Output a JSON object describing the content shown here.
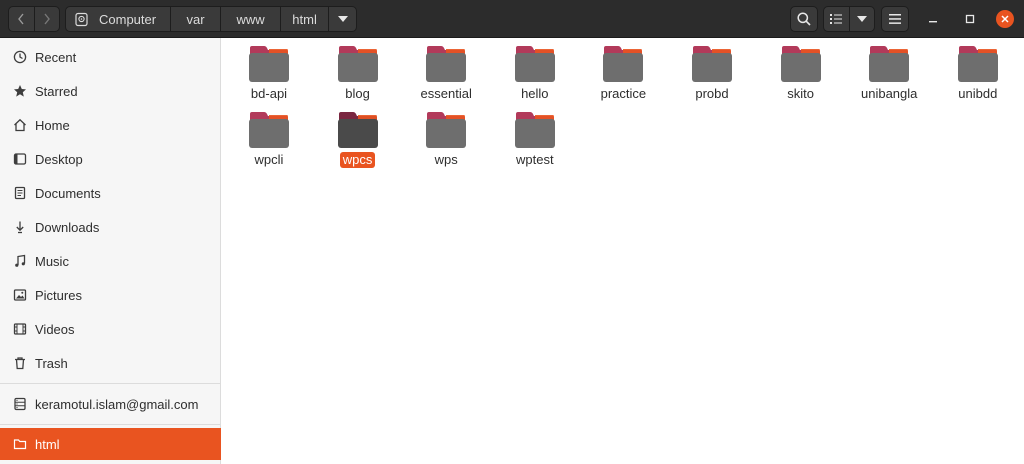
{
  "path": {
    "crumbs": [
      "Computer",
      "var",
      "www",
      "html"
    ]
  },
  "sidebar": {
    "places": [
      {
        "label": "Recent",
        "icon": "clock-icon"
      },
      {
        "label": "Starred",
        "icon": "star-icon"
      },
      {
        "label": "Home",
        "icon": "home-icon"
      },
      {
        "label": "Desktop",
        "icon": "desktop-icon"
      },
      {
        "label": "Documents",
        "icon": "document-icon"
      },
      {
        "label": "Downloads",
        "icon": "download-icon"
      },
      {
        "label": "Music",
        "icon": "music-icon"
      },
      {
        "label": "Pictures",
        "icon": "picture-icon"
      },
      {
        "label": "Videos",
        "icon": "video-icon"
      },
      {
        "label": "Trash",
        "icon": "trash-icon"
      }
    ],
    "account": {
      "label": "keramotul.islam@gmail.com",
      "icon": "network-server-icon"
    },
    "bookmark": {
      "label": "html",
      "icon": "folder-icon"
    }
  },
  "folders": {
    "items": [
      "bd-api",
      "blog",
      "essential",
      "hello",
      "practice",
      "probd",
      "skito",
      "unibangla",
      "unibdd",
      "wpcli",
      "wpcs",
      "wps",
      "wptest"
    ],
    "selected": "wpcs"
  },
  "colors": {
    "accent": "#e95420",
    "folder_body": "#6e6e6e",
    "folder_tab": "#b23a5a",
    "headerbar": "#2c2c2c"
  }
}
